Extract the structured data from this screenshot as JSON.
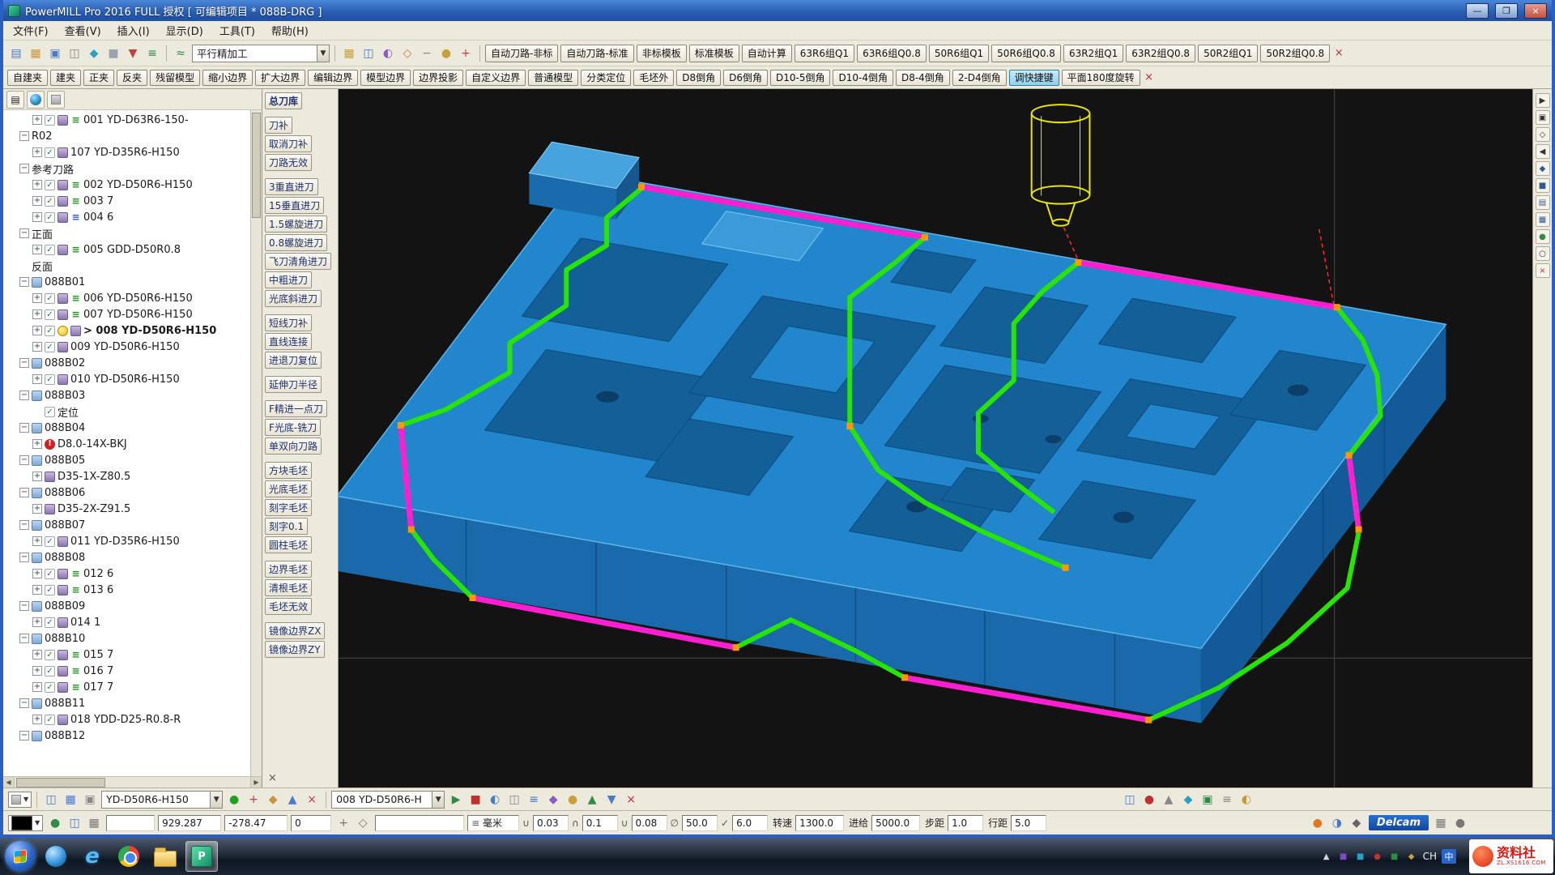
{
  "window": {
    "title": "PowerMILL Pro 2016 FULL 授权   [ 可编辑项目 * 088B-DRG ]"
  },
  "menu": [
    "文件(F)",
    "查看(V)",
    "插入(I)",
    "显示(D)",
    "工具(T)",
    "帮助(H)"
  ],
  "toolbar1": {
    "combo": "平行精加工",
    "buttons": [
      "自动刀路-非标",
      "自动刀路-标准",
      "非标模板",
      "标准模板",
      "自动计算",
      "63R6组Q1",
      "63R6组Q0.8",
      "50R6组Q1",
      "50R6组Q0.8",
      "63R2组Q1",
      "63R2组Q0.8",
      "50R2组Q1",
      "50R2组Q0.8"
    ]
  },
  "toolbar2": {
    "active": "调快捷键",
    "buttons": [
      "自建夹",
      "建夹",
      "正夹",
      "反夹",
      "残留模型",
      "缩小边界",
      "扩大边界",
      "编辑边界",
      "模型边界",
      "边界投影",
      "自定义边界",
      "普通模型",
      "分类定位",
      "毛坯外",
      "D8倒角",
      "D6倒角",
      "D10-5倒角",
      "D10-4倒角",
      "D8-4倒角",
      "2-D4倒角",
      "调快捷键",
      "平面180度旋转"
    ]
  },
  "macro": {
    "title": "总刀库",
    "groups": [
      [
        "刀补",
        "取消刀补",
        "刀路无效"
      ],
      [
        "3重直进刀",
        "15垂直进刀",
        "1.5螺旋进刀",
        "0.8螺旋进刀",
        "飞刀清角进刀",
        "中粗进刀",
        "光底斜进刀"
      ],
      [
        "短线刀补",
        "直线连接",
        "进退刀复位"
      ],
      [
        "延伸刀半径"
      ],
      [
        "F精进一点刀",
        "F光底-铣刀",
        "单双向刀路"
      ],
      [
        "方块毛坯",
        "光底毛坯",
        "刻字毛坯",
        "刻字0.1",
        "圆柱毛坯"
      ],
      [
        "边界毛坯",
        "清根毛坯",
        "毛坯无效"
      ],
      [
        "镜像边界ZX",
        "镜像边界ZY"
      ]
    ]
  },
  "tree": {
    "items": [
      {
        "ind": 2,
        "exp": "+",
        "icons": [
          "chk",
          "tool",
          "lay"
        ],
        "label": "001 YD-D63R6-150-"
      },
      {
        "ind": 1,
        "exp": "-",
        "icons": [],
        "label": "R02"
      },
      {
        "ind": 2,
        "exp": "+",
        "icons": [
          "chk",
          "tool"
        ],
        "label": "107 YD-D35R6-H150"
      },
      {
        "ind": 1,
        "exp": "-",
        "icons": [],
        "label": "参考刀路"
      },
      {
        "ind": 2,
        "exp": "+",
        "icons": [
          "chk",
          "tool",
          "lay"
        ],
        "label": "002 YD-D50R6-H150"
      },
      {
        "ind": 2,
        "exp": "+",
        "icons": [
          "chk",
          "tool",
          "lay"
        ],
        "label": "003 7"
      },
      {
        "ind": 2,
        "exp": "+",
        "icons": [
          "chk",
          "tool",
          "layb"
        ],
        "label": "004 6"
      },
      {
        "ind": 1,
        "exp": "-",
        "icons": [],
        "label": "正面"
      },
      {
        "ind": 2,
        "exp": "+",
        "icons": [
          "chk",
          "tool",
          "lay"
        ],
        "label": "005 GDD-D50R0.8"
      },
      {
        "ind": 1,
        "exp": "",
        "icons": [],
        "label": "反面"
      },
      {
        "ind": 1,
        "exp": "-",
        "icons": [
          "fold"
        ],
        "label": "088B01"
      },
      {
        "ind": 2,
        "exp": "+",
        "icons": [
          "chk",
          "tool",
          "lay"
        ],
        "label": "006 YD-D50R6-H150"
      },
      {
        "ind": 2,
        "exp": "+",
        "icons": [
          "chk",
          "tool",
          "lay"
        ],
        "label": "007 YD-D50R6-H150"
      },
      {
        "ind": 2,
        "exp": "+",
        "icons": [
          "chk",
          "bulb",
          "tool"
        ],
        "label": "> 008 YD-D50R6-H150",
        "bold": true
      },
      {
        "ind": 2,
        "exp": "+",
        "icons": [
          "chk",
          "tool"
        ],
        "label": "009 YD-D50R6-H150"
      },
      {
        "ind": 1,
        "exp": "-",
        "icons": [
          "fold"
        ],
        "label": "088B02"
      },
      {
        "ind": 2,
        "exp": "+",
        "icons": [
          "chk",
          "tool"
        ],
        "label": "010 YD-D50R6-H150"
      },
      {
        "ind": 1,
        "exp": "-",
        "icons": [
          "fold"
        ],
        "label": "088B03"
      },
      {
        "ind": 2,
        "exp": "",
        "icons": [
          "chk"
        ],
        "label": "定位"
      },
      {
        "ind": 1,
        "exp": "-",
        "icons": [
          "fold"
        ],
        "label": "088B04"
      },
      {
        "ind": 2,
        "exp": "+",
        "icons": [
          "warn"
        ],
        "label": "D8.0-14X-BKJ"
      },
      {
        "ind": 1,
        "exp": "-",
        "icons": [
          "fold"
        ],
        "label": "088B05"
      },
      {
        "ind": 2,
        "exp": "+",
        "icons": [
          "tool"
        ],
        "label": "D35-1X-Z80.5"
      },
      {
        "ind": 1,
        "exp": "-",
        "icons": [
          "fold"
        ],
        "label": "088B06"
      },
      {
        "ind": 2,
        "exp": "+",
        "icons": [
          "tool"
        ],
        "label": "D35-2X-Z91.5"
      },
      {
        "ind": 1,
        "exp": "-",
        "icons": [
          "fold"
        ],
        "label": "088B07"
      },
      {
        "ind": 2,
        "exp": "+",
        "icons": [
          "chkb",
          "tool"
        ],
        "label": "011 YD-D35R6-H150"
      },
      {
        "ind": 1,
        "exp": "-",
        "icons": [
          "fold"
        ],
        "label": "088B08"
      },
      {
        "ind": 2,
        "exp": "+",
        "icons": [
          "chkb",
          "tool",
          "lay"
        ],
        "label": "012 6"
      },
      {
        "ind": 2,
        "exp": "+",
        "icons": [
          "chkb",
          "tool",
          "lay"
        ],
        "label": "013 6"
      },
      {
        "ind": 1,
        "exp": "-",
        "icons": [
          "fold"
        ],
        "label": "088B09"
      },
      {
        "ind": 2,
        "exp": "+",
        "icons": [
          "chkb",
          "tool"
        ],
        "label": "014 1"
      },
      {
        "ind": 1,
        "exp": "-",
        "icons": [
          "fold"
        ],
        "label": "088B10"
      },
      {
        "ind": 2,
        "exp": "+",
        "icons": [
          "chk",
          "tool",
          "lay"
        ],
        "label": "015 7"
      },
      {
        "ind": 2,
        "exp": "+",
        "icons": [
          "chk",
          "tool",
          "lay"
        ],
        "label": "016 7"
      },
      {
        "ind": 2,
        "exp": "+",
        "icons": [
          "chk",
          "tool",
          "lay"
        ],
        "label": "017 7"
      },
      {
        "ind": 1,
        "exp": "-",
        "icons": [
          "fold"
        ],
        "label": "088B11"
      },
      {
        "ind": 2,
        "exp": "+",
        "icons": [
          "chk",
          "tool"
        ],
        "label": "018 YDD-D25-R0.8-R"
      },
      {
        "ind": 1,
        "exp": "-",
        "icons": [
          "fold"
        ],
        "label": "088B12"
      }
    ]
  },
  "bottom": {
    "tool_combo": "YD-D50R6-H150",
    "toolpath_combo": "008 YD-D50R6-H"
  },
  "status": {
    "x": "929.287",
    "y": "-278.47",
    "z": "0",
    "units": "毫米",
    "tolerance": "0.03",
    "thickness": "0.1",
    "stock": "0.08",
    "diameter": "50.0",
    "length": "6.0",
    "spindle_label": "转速",
    "spindle": "1300.0",
    "feed_label": "进给",
    "feed": "5000.0",
    "step_label": "步距",
    "step": "1.0",
    "pitch_label": "行距",
    "pitch": "5.0",
    "brand": "Delcam"
  },
  "taskbar": {
    "lang": "CH",
    "ime": "中"
  },
  "watermark": {
    "title": "资料社",
    "url": "ZL.XS1616.COM"
  },
  "icons": {
    "tb1_left": [
      {
        "n": "new-project-icon",
        "g": "▤",
        "c": "#4a7ac8"
      },
      {
        "n": "open-project-icon",
        "g": "▦",
        "c": "#c8963a"
      },
      {
        "n": "save-project-icon",
        "g": "▣",
        "c": "#4a7ac8"
      },
      {
        "n": "print-icon",
        "g": "◫",
        "c": "#888888"
      },
      {
        "n": "model-icon",
        "g": "◆",
        "c": "#2aa0c8"
      },
      {
        "n": "block-icon",
        "g": "■",
        "c": "#9aa4b0"
      },
      {
        "n": "tool-create-icon",
        "g": "▼",
        "c": "#c04040"
      },
      {
        "n": "nc-program-icon",
        "g": "≡",
        "c": "#2f8c46"
      }
    ],
    "tb1_mid": [
      {
        "n": "toolbox-icon",
        "g": "▦",
        "c": "#c8a03a"
      },
      {
        "n": "calculator-icon",
        "g": "◫",
        "c": "#4a7ac8"
      },
      {
        "n": "mirror-icon",
        "g": "◐",
        "c": "#8a5ac8"
      },
      {
        "n": "transform-icon",
        "g": "◇",
        "c": "#c87a3a"
      },
      {
        "n": "measure-icon",
        "g": "−",
        "c": "#888888"
      },
      {
        "n": "stopwatch-icon",
        "g": "●",
        "c": "#c8a03a"
      },
      {
        "n": "batch-icon",
        "g": "+",
        "c": "#c04040"
      }
    ],
    "rail": [
      {
        "n": "cursor-icon",
        "g": "▶",
        "c": "#333333"
      },
      {
        "n": "box-select-icon",
        "g": "▣",
        "c": "#333333"
      },
      {
        "n": "zoom-fit-icon",
        "g": "◇",
        "c": "#333333"
      },
      {
        "n": "previous-view-icon",
        "g": "◀",
        "c": "#333333"
      },
      {
        "n": "iso-view-icon",
        "g": "◆",
        "c": "#335a8c"
      },
      {
        "n": "top-view-icon",
        "g": "■",
        "c": "#335a8c"
      },
      {
        "n": "front-view-icon",
        "g": "▤",
        "c": "#335a8c"
      },
      {
        "n": "side-view-icon",
        "g": "▦",
        "c": "#335a8c"
      },
      {
        "n": "shaded-icon",
        "g": "●",
        "c": "#2f8c46"
      },
      {
        "n": "wireframe-icon",
        "g": "○",
        "c": "#333333"
      },
      {
        "n": "rail-close-icon",
        "g": "×",
        "c": "#c03030"
      }
    ],
    "bt_a": [
      {
        "n": "levels-icon",
        "g": "◫",
        "c": "#4a7ac8"
      },
      {
        "n": "table-icon",
        "g": "▦",
        "c": "#4a7ac8"
      },
      {
        "n": "grid-icon",
        "g": "▣",
        "c": "#888888"
      }
    ],
    "bt_b": [
      {
        "n": "shaded-view-icon",
        "g": "●",
        "c": "#22a022"
      },
      {
        "n": "draw-tool-icon",
        "g": "+",
        "c": "#c04040"
      },
      {
        "n": "edit-tool-icon",
        "g": "◆",
        "c": "#c8963a"
      },
      {
        "n": "probe-icon",
        "g": "▲",
        "c": "#4a7ac8"
      },
      {
        "n": "cut-icon",
        "g": "×",
        "c": "#c04040"
      }
    ],
    "bt_c": [
      {
        "n": "simulate-play-icon",
        "g": "▶",
        "c": "#2f8c46"
      },
      {
        "n": "simulate-stop-icon",
        "g": "■",
        "c": "#c03030"
      },
      {
        "n": "shade-toggle-icon",
        "g": "◐",
        "c": "#4a7ac8"
      },
      {
        "n": "collision-icon",
        "g": "◫",
        "c": "#888888"
      },
      {
        "n": "list-icon",
        "g": "≡",
        "c": "#4a7ac8"
      },
      {
        "n": "gem-icon",
        "g": "◆",
        "c": "#8a5ac8"
      },
      {
        "n": "clock-icon",
        "g": "●",
        "c": "#c8a03a"
      },
      {
        "n": "raise-icon",
        "g": "▲",
        "c": "#2f8c46"
      },
      {
        "n": "lower-icon",
        "g": "▼",
        "c": "#4a7ac8"
      },
      {
        "n": "panel-close-icon",
        "g": "×",
        "c": "#c03030"
      }
    ],
    "bt_d": [
      {
        "n": "leads-icon",
        "g": "◫",
        "c": "#4a7ac8"
      },
      {
        "n": "feeds-icon",
        "g": "●",
        "c": "#c03030"
      },
      {
        "n": "boundary-icon",
        "g": "▲",
        "c": "#888888"
      },
      {
        "n": "pattern-icon",
        "g": "◆",
        "c": "#2aa0c8"
      },
      {
        "n": "verify-icon",
        "g": "▣",
        "c": "#2f8c46"
      },
      {
        "n": "notes-icon",
        "g": "≡",
        "c": "#888888"
      },
      {
        "n": "half-icon",
        "g": "◐",
        "c": "#c8963a"
      }
    ],
    "status_left": [
      {
        "n": "world-small-icon",
        "g": "●",
        "c": "#2f8c46"
      },
      {
        "n": "levels-small-icon",
        "g": "◫",
        "c": "#4a7ac8"
      },
      {
        "n": "grid-small-icon",
        "g": "▦",
        "c": "#777777"
      }
    ],
    "status_mid": [
      {
        "n": "axis-icon",
        "g": "+",
        "c": "#777777"
      },
      {
        "n": "snap-icon",
        "g": "◇",
        "c": "#777777"
      }
    ],
    "status_right": [
      {
        "n": "refresh-icon",
        "g": "●",
        "c": "#e07820"
      },
      {
        "n": "ime-small-icon",
        "g": "◑",
        "c": "#4a7ac8"
      },
      {
        "n": "sound-icon",
        "g": "◆",
        "c": "#666666"
      }
    ],
    "status_tools": [
      {
        "n": "recycle-icon",
        "g": "▦",
        "c": "#777777"
      },
      {
        "n": "settings-gear-icon",
        "g": "●",
        "c": "#777777"
      }
    ],
    "tray": [
      {
        "n": "tray-expand-icon",
        "g": "▲",
        "c": "#cfd8e0"
      },
      {
        "n": "tray-app1-icon",
        "g": "■",
        "c": "#7a4ac8"
      },
      {
        "n": "tray-app2-icon",
        "g": "■",
        "c": "#2aa0c8"
      },
      {
        "n": "tray-alert-icon",
        "g": "●",
        "c": "#c03030"
      },
      {
        "n": "tray-safe-icon",
        "g": "■",
        "c": "#2f8c46"
      },
      {
        "n": "tray-update-icon",
        "g": "◆",
        "c": "#c8a03a"
      }
    ]
  }
}
